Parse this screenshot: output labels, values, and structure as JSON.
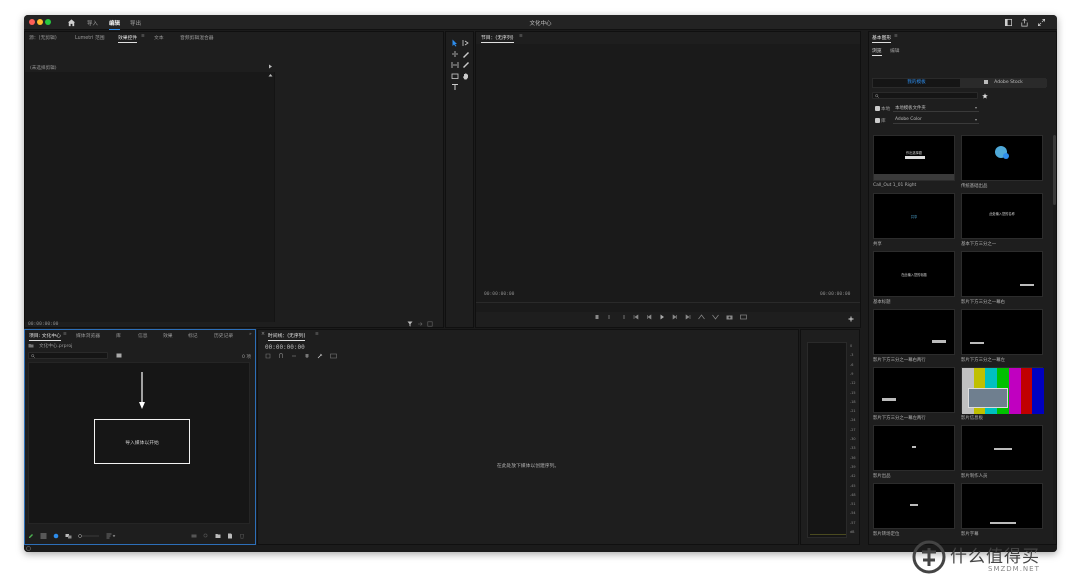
{
  "app": {
    "title": "文化中心",
    "workspace_tabs": [
      "导入",
      "编辑",
      "导出"
    ],
    "active_workspace": "编辑"
  },
  "source_panel": {
    "tabs": [
      "源：(无剪辑)",
      "Lumetri 范围",
      "效果控件",
      "文本",
      "音频剪辑混合器"
    ],
    "active_tab": "效果控件",
    "content_label": "(未选择剪辑)",
    "timecode": "00:00:00:00"
  },
  "program_panel": {
    "title": "节目：(无序列)",
    "timecode_left": "00:00:00:00",
    "timecode_right": "00:00:00:00"
  },
  "project_panel": {
    "tabs": [
      "项目: 文化中心",
      "媒体浏览器",
      "库",
      "信息",
      "效果",
      "标记",
      "历史记录"
    ],
    "active_tab": "项目: 文化中心",
    "project_file": "文化中心.prproj",
    "item_count": "0 项",
    "import_hint": "导入媒体以开始"
  },
  "timeline_panel": {
    "title": "时间线：(无序列)",
    "timecode": "00:00:00:00",
    "drop_hint": "在此处放下媒体以创建序列。"
  },
  "audio_meter": {
    "ticks": [
      "0",
      "-3",
      "-6",
      "-9",
      "-12",
      "-15",
      "-18",
      "-21",
      "-24",
      "-27",
      "-30",
      "-33",
      "-36",
      "-39",
      "-42",
      "-45",
      "-48",
      "-51",
      "-54",
      "-57",
      "dB"
    ]
  },
  "essential_graphics": {
    "title": "基本图形",
    "tabs": [
      "浏览",
      "编辑"
    ],
    "active_tab": "浏览",
    "sources": [
      "我的模板",
      "Adobe Stock"
    ],
    "active_source": "我的模板",
    "filter_local_label": "本地",
    "filter_local_value": "本地模板文件夹",
    "filter_lib_label": "库",
    "filter_lib_value": "Adobe Color",
    "templates": [
      {
        "label": "Call_Out 1_01 Right",
        "thumb_text": "作出选择题"
      },
      {
        "label": "传统基础出品",
        "thumb_text": ""
      },
      {
        "label": "共享",
        "thumb_text": "共享"
      },
      {
        "label": "基本下方三分之一",
        "thumb_text": "此处输入您的名称"
      },
      {
        "label": "基本标题",
        "thumb_text": "在此输入您的标题"
      },
      {
        "label": "影片下方三分之一幕右",
        "thumb_text": ""
      },
      {
        "label": "影片下方三分之一幕右两行",
        "thumb_text": ""
      },
      {
        "label": "影片下方三分之一幕左",
        "thumb_text": ""
      },
      {
        "label": "影片下方三分之一幕左两行",
        "thumb_text": ""
      },
      {
        "label": "影片信息板",
        "thumb_text": ""
      },
      {
        "label": "影片出品",
        "thumb_text": ""
      },
      {
        "label": "影片制作人员",
        "thumb_text": ""
      },
      {
        "label": "影片转场定位",
        "thumb_text": ""
      },
      {
        "label": "影片字幕",
        "thumb_text": ""
      }
    ]
  },
  "watermark": {
    "text": "什么值得买",
    "sub": "SMZDM.NET"
  },
  "colors": {
    "accent": "#2d8ceb",
    "panel_bg": "#1e1e1e",
    "frame_bg": "#1b1b1b",
    "project_border": "#2d6fb8"
  }
}
